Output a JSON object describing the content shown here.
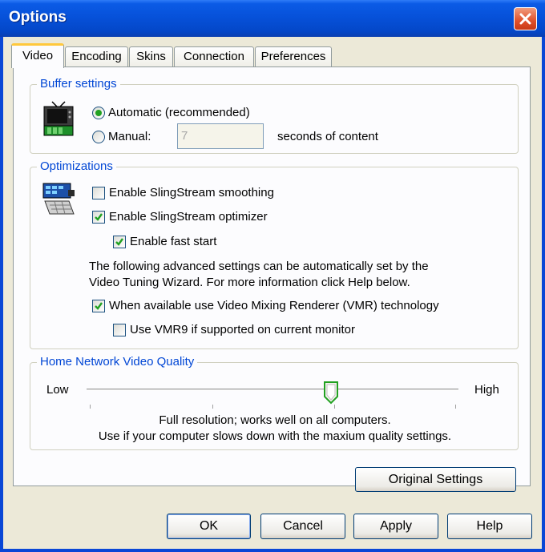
{
  "window": {
    "title": "Options"
  },
  "tabs": [
    {
      "label": "Video",
      "active": true
    },
    {
      "label": "Encoding",
      "active": false
    },
    {
      "label": "Skins",
      "active": false
    },
    {
      "label": "Connection",
      "active": false
    },
    {
      "label": "Preferences",
      "active": false
    }
  ],
  "buffer": {
    "legend": "Buffer settings",
    "automatic_label": "Automatic (recommended)",
    "automatic_selected": true,
    "manual_label": "Manual:",
    "manual_value": "7",
    "suffix": "seconds of content"
  },
  "optimizations": {
    "legend": "Optimizations",
    "smoothing_label": "Enable SlingStream smoothing",
    "smoothing_checked": false,
    "optimizer_label": "Enable SlingStream optimizer",
    "optimizer_checked": true,
    "fast_start_label": "Enable fast start",
    "fast_start_checked": true,
    "info_line1": "The following advanced settings can be automatically set by the",
    "info_line2": "Video Tuning Wizard.  For more information click Help below.",
    "vmr_label": "When available use Video Mixing Renderer (VMR) technology",
    "vmr_checked": true,
    "vmr9_label": "Use VMR9 if supported on current monitor",
    "vmr9_checked": false
  },
  "quality": {
    "legend": "Home Network Video Quality",
    "low_label": "Low",
    "high_label": "High",
    "slider_value_percent": 66,
    "desc_line1": "Full resolution; works well on all computers.",
    "desc_line2": "Use if your computer slows down with the maxium quality settings."
  },
  "original_settings_label": "Original Settings",
  "buttons": {
    "ok": "OK",
    "cancel": "Cancel",
    "apply": "Apply",
    "help": "Help"
  },
  "colors": {
    "title_bar": "#0650d8",
    "legend_text": "#0046d5",
    "tab_highlight": "#ffc83c",
    "check_mark": "#21a121",
    "close_button": "#e0502a"
  }
}
